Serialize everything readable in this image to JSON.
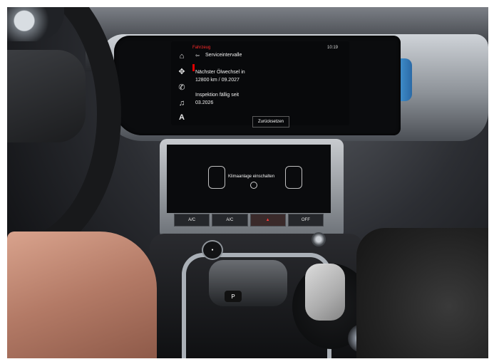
{
  "infotainment": {
    "breadcrumb": "Fahrzeug",
    "title": "Serviceintervalle",
    "oil_label": "Nächster Ölwechsel in",
    "oil_value": "12800 km / 09.2027",
    "inspection_label": "Inspektion fällig seit",
    "inspection_value": "03.2026",
    "reset_button": "Zurücksetzen",
    "clock": "10:19",
    "sidebar_icons": [
      "home-icon",
      "navigation-icon",
      "phone-icon",
      "media-icon"
    ]
  },
  "climate_screen": {
    "message": "Klimaanlage einschalten"
  },
  "hvac_buttons": [
    "A/C",
    "A/C",
    "OFF"
  ],
  "shifter_label": "P",
  "colors": {
    "alert_red": "#e00000",
    "ambient_blue": "#4da7e6"
  }
}
